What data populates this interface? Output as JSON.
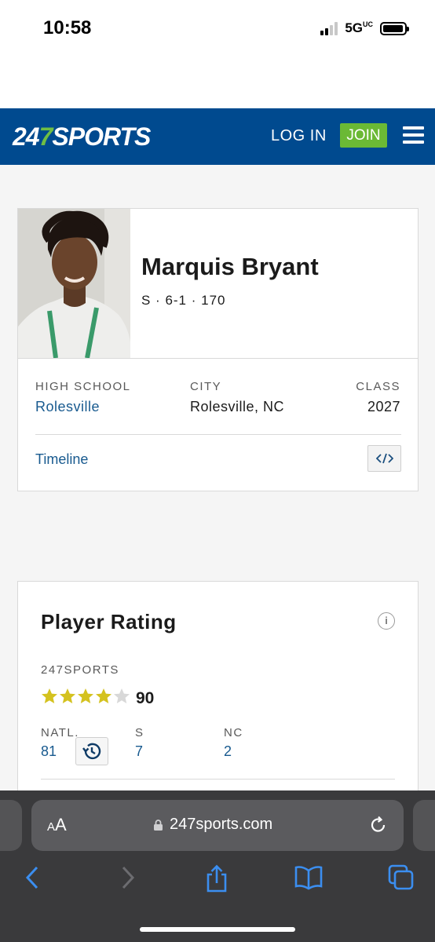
{
  "status_bar": {
    "time": "10:58",
    "network": "5G",
    "network_suffix": "UC"
  },
  "header": {
    "logo_num": "24",
    "logo_seven": "7",
    "logo_word": "SPORTS",
    "login_label": "LOG IN",
    "join_label": "JOIN",
    "brand_color": "#004a8f",
    "join_color": "#6bb935"
  },
  "player": {
    "name": "Marquis Bryant",
    "meta": "S · 6-1 · 170",
    "high_school_label": "HIGH SCHOOL",
    "high_school": "Rolesville",
    "city_label": "CITY",
    "city": "Rolesville, NC",
    "class_label": "CLASS",
    "class_year": "2027",
    "timeline_label": "Timeline"
  },
  "rating": {
    "title": "Player Rating",
    "info_icon": "i",
    "source_label": "247SPORTS",
    "stars_filled": 4,
    "stars_total": 5,
    "score": "90",
    "ranks": [
      {
        "label": "NATL.",
        "value": "81"
      },
      {
        "label": "S",
        "value": "7"
      },
      {
        "label": "NC",
        "value": "2"
      }
    ]
  },
  "browser": {
    "reader_small": "A",
    "reader_large": "A",
    "url": "247sports.com"
  }
}
